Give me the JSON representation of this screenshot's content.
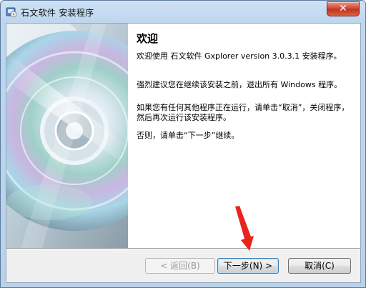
{
  "window": {
    "title": "石文软件 安装程序",
    "close_label": "✕"
  },
  "content": {
    "heading": "欢迎",
    "paragraph1": "欢迎使用 石文软件 Gxplorer version 3.0.3.1 安装程序。",
    "paragraph2": "强烈建议您在继续该安装之前，退出所有 Windows 程序。",
    "paragraph3": "如果您有任何其他程序正在运行，请单击“取消”，关闭程序，然后再次运行该安装程序。",
    "paragraph4": "否则，请单击“下一步”继续。"
  },
  "buttons": {
    "back": "< 返回(B)",
    "next": "下一步(N) >",
    "cancel": "取消(C)"
  },
  "colors": {
    "titlebar": "#cfe2f4",
    "close": "#c1341f",
    "cursor": "#e8251b"
  }
}
